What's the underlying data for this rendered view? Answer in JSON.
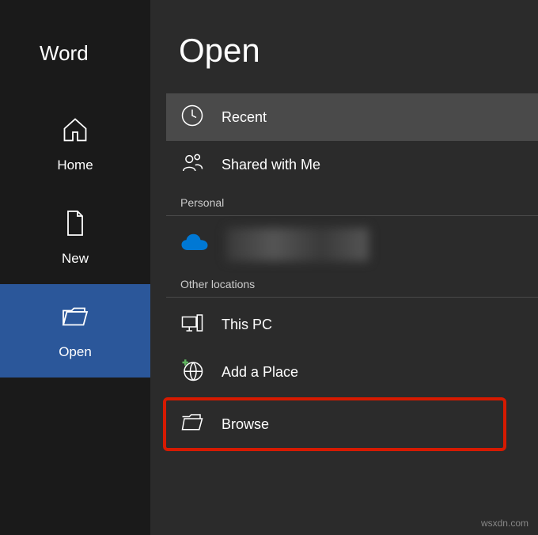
{
  "app": {
    "title": "Word"
  },
  "nav": {
    "home": "Home",
    "new": "New",
    "open": "Open"
  },
  "page": {
    "title": "Open"
  },
  "locations": {
    "recent": "Recent",
    "shared": "Shared with Me",
    "personal_header": "Personal",
    "other_header": "Other locations",
    "this_pc": "This PC",
    "add_place": "Add a Place",
    "browse": "Browse"
  },
  "watermark": "wsxdn.com"
}
